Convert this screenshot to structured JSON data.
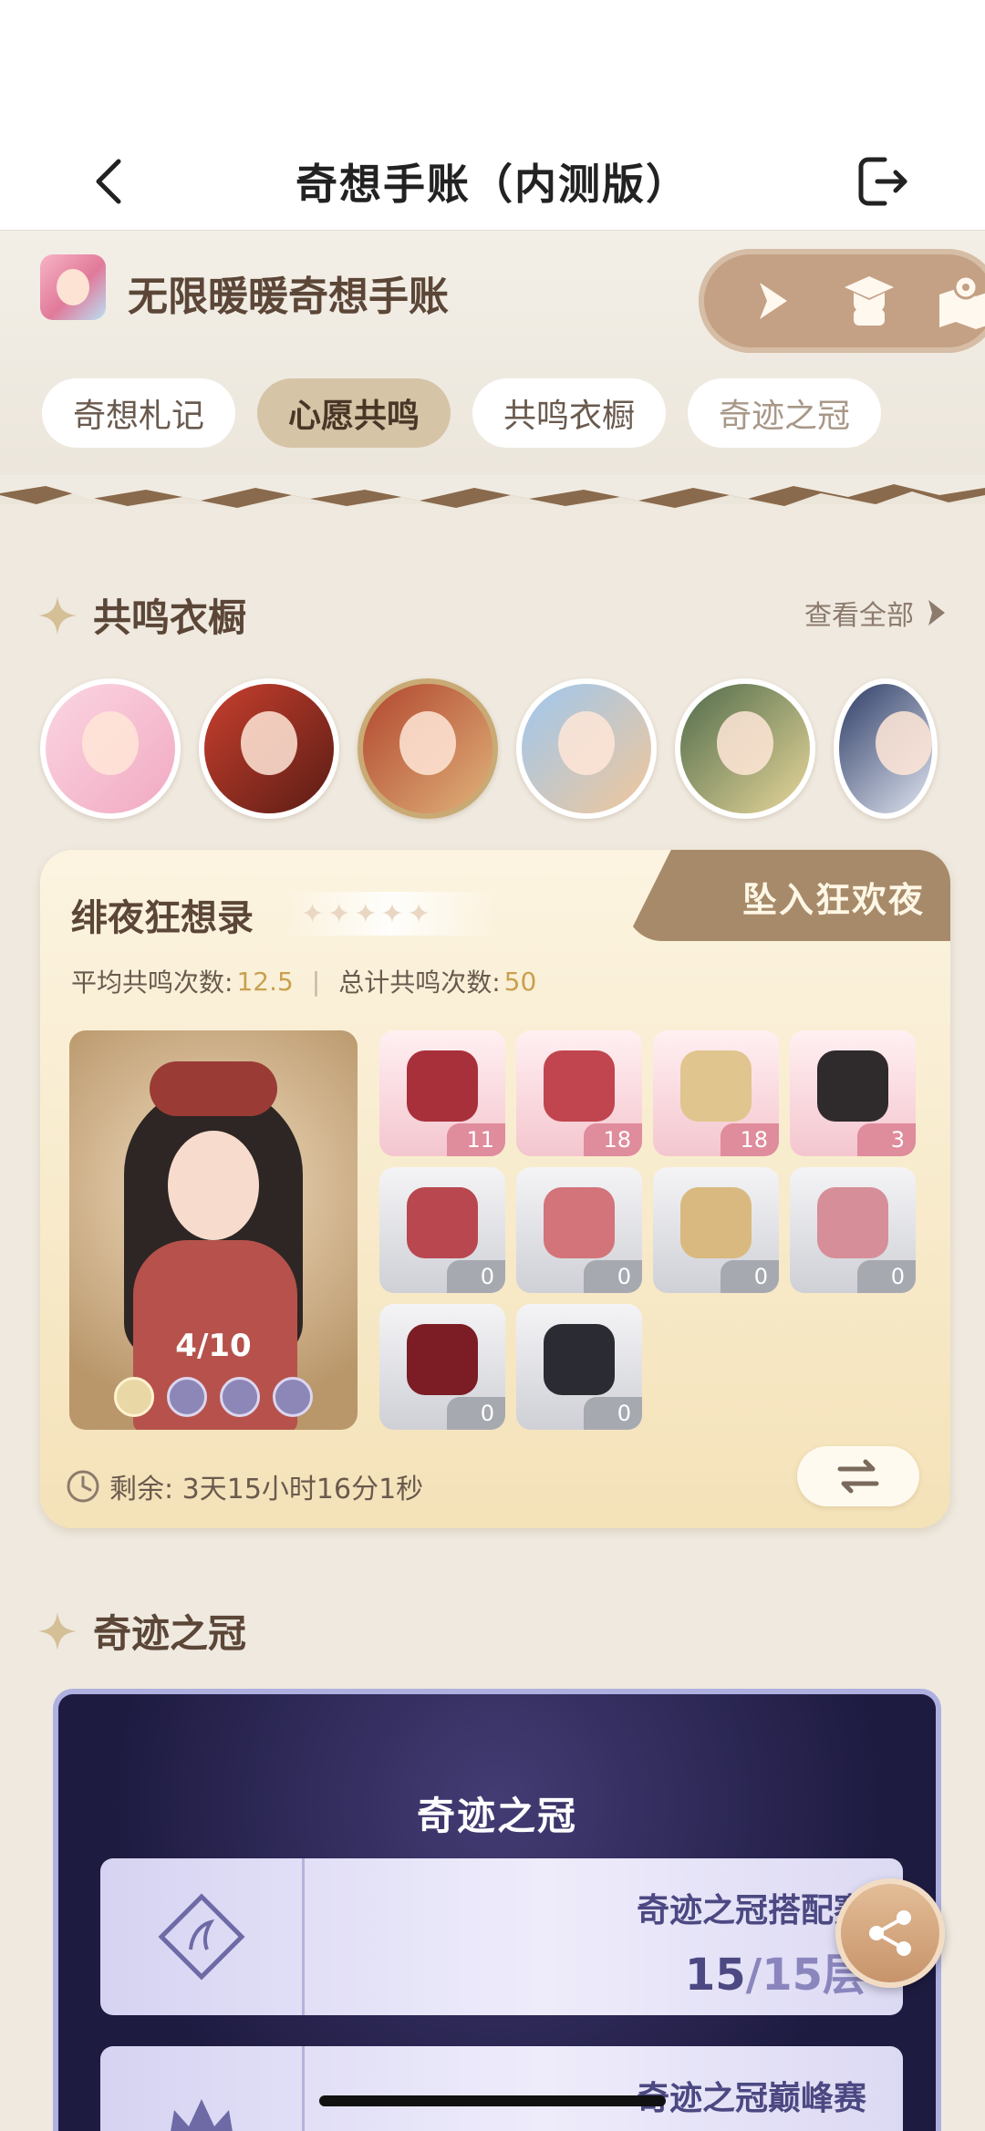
{
  "nav": {
    "title": "奇想手账（内测版）"
  },
  "header": {
    "app_name": "无限暖暖奇想手账",
    "tabs": [
      {
        "label": "奇想札记"
      },
      {
        "label": "心愿共鸣"
      },
      {
        "label": "共鸣衣橱"
      },
      {
        "label": "奇迹之冠"
      }
    ],
    "active_tab": "心愿共鸣"
  },
  "wardrobe": {
    "title": "共鸣衣橱",
    "view_all": "查看全部",
    "selected_avatar_index": 2
  },
  "outfit_card": {
    "title": "绯夜狂想录",
    "star_count": 5,
    "action_label": "坠入狂欢夜",
    "avg_label": "平均共鸣次数:",
    "avg_value": "12.5",
    "total_label": "总计共鸣次数:",
    "total_value": "50",
    "progress": "4/10",
    "items": [
      {
        "count": "11",
        "state": "owned",
        "color": "#a8303a"
      },
      {
        "count": "18",
        "state": "owned",
        "color": "#c0454e"
      },
      {
        "count": "18",
        "state": "owned",
        "color": "#e0c58e"
      },
      {
        "count": "3",
        "state": "owned",
        "color": "#2f2a2c"
      },
      {
        "count": "0",
        "state": "empty",
        "color": "#b8474f"
      },
      {
        "count": "0",
        "state": "empty",
        "color": "#d3737a"
      },
      {
        "count": "0",
        "state": "empty",
        "color": "#d9b97f"
      },
      {
        "count": "0",
        "state": "empty",
        "color": "#d68e99"
      },
      {
        "count": "0",
        "state": "empty",
        "color": "#7c1d26"
      },
      {
        "count": "0",
        "state": "empty",
        "color": "#2b2b33"
      }
    ],
    "remaining": "剩余: 3天15小时16分1秒"
  },
  "crown": {
    "section_title": "奇迹之冠",
    "card_title": "奇迹之冠",
    "rows": [
      {
        "name": "奇迹之冠搭配赛",
        "score": "15",
        "score_total": "/15层"
      },
      {
        "name": "奇迹之冠巅峰赛",
        "score": "",
        "score_total": ""
      }
    ]
  },
  "colors": {
    "accent": "#c9a04f",
    "tab_active": "#d6c4a7",
    "crown_bg": "#1e1b41"
  }
}
